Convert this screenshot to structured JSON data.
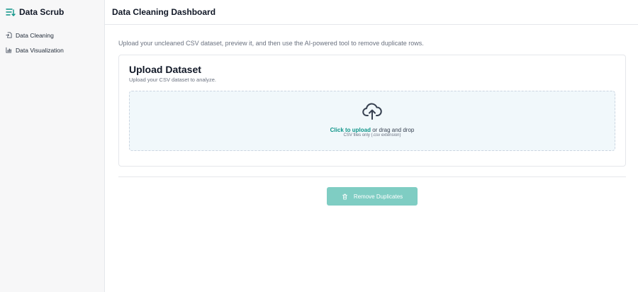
{
  "sidebar": {
    "brand": {
      "title": "Data Scrub",
      "icon": "list-filter-icon"
    },
    "items": [
      {
        "label": "Data Cleaning",
        "icon": "file-import-icon"
      },
      {
        "label": "Data Visualization",
        "icon": "bar-chart-icon"
      }
    ]
  },
  "header": {
    "title": "Data Cleaning Dashboard"
  },
  "main": {
    "intro": "Upload your uncleaned CSV dataset, preview it, and then use the AI-powered tool to remove duplicate rows.",
    "upload_card": {
      "title": "Upload Dataset",
      "subtitle": "Upload your CSV dataset to analyze.",
      "dropzone": {
        "icon": "cloud-upload-icon",
        "link_text": "Click to upload",
        "rest_text": " or drag and drop",
        "hint": "CSV files only (.csv extension)"
      }
    },
    "remove_button": {
      "label": "Remove Duplicates",
      "icon": "trash-icon"
    }
  },
  "colors": {
    "accent": "#0d9488",
    "button_disabled": "#7fcdc3",
    "dropzone_bg": "#f1f8fb",
    "sidebar_bg": "#f7f7f8"
  }
}
